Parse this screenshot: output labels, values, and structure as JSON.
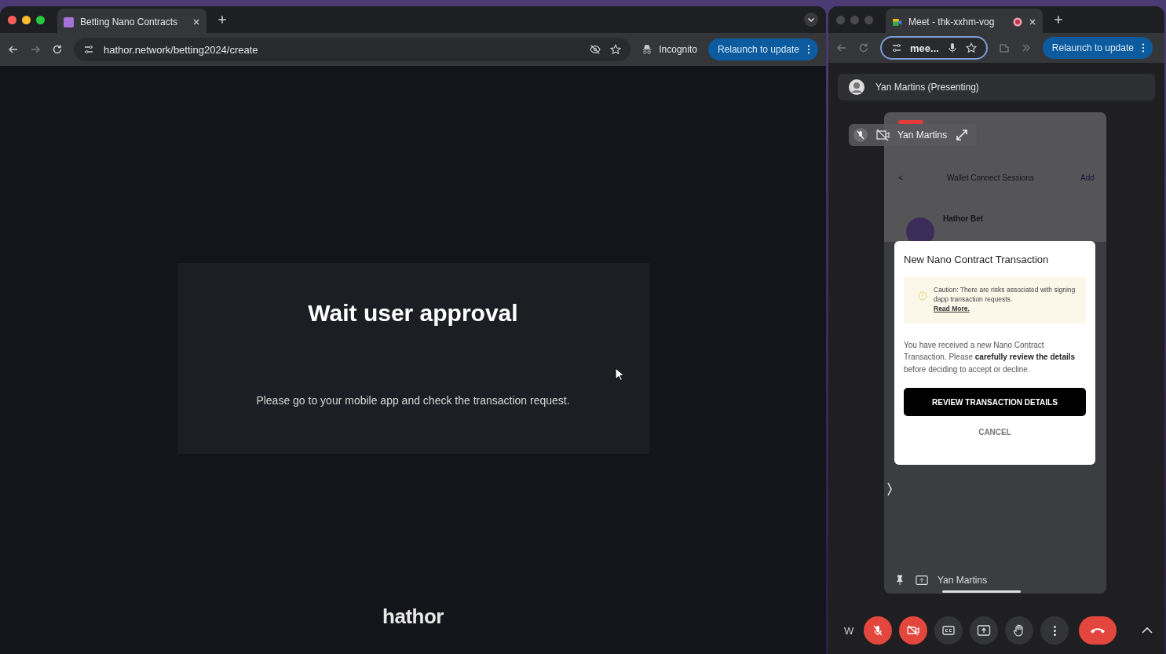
{
  "left_window": {
    "focused": true,
    "tab": {
      "title": "Betting Nano Contracts"
    },
    "url": "hathor.network/betting2024/create",
    "incognito": "Incognito",
    "relaunch": "Relaunch to update",
    "page": {
      "title": "Wait user approval",
      "message": "Please go to your mobile app and check the transaction request.",
      "logo": "hathor"
    }
  },
  "right_window": {
    "focused": false,
    "tab": {
      "title": "Meet - thk-xxhm-vog"
    },
    "address": "mee...",
    "relaunch": "Relaunch to update",
    "presenter": "Yan Martins (Presenting)",
    "tile": {
      "name": "Yan Martins",
      "phone": {
        "back": "<",
        "screen_title": "Wallet Connect Sessions",
        "action": "Add",
        "dapp_name": "Hathor Bet"
      },
      "modal": {
        "title": "New Nano Contract Transaction",
        "caution": "Caution: There are risks associated with signing dapp transaction requests.",
        "read_more": "Read More.",
        "body": "You have received a new Nano Contract Transaction. Please **carefully review the details** before deciding to accept or decline.",
        "primary": "REVIEW TRANSACTION DETAILS",
        "secondary": "CANCEL"
      },
      "footer_name": "Yan Martins"
    },
    "meeting_code": "W",
    "controls": [
      {
        "kind": "mic_off"
      },
      {
        "kind": "camera_off"
      },
      {
        "kind": "captions"
      },
      {
        "kind": "present"
      },
      {
        "kind": "hand"
      },
      {
        "kind": "more"
      },
      {
        "kind": "hangup"
      }
    ]
  }
}
